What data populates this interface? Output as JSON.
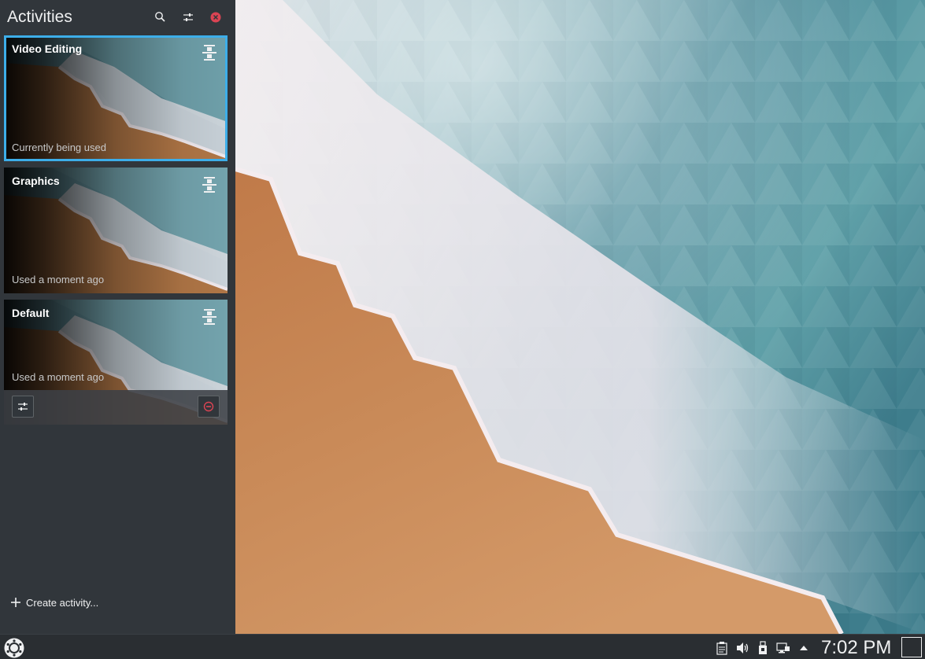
{
  "activities_panel": {
    "title": "Activities",
    "search_icon": "search-icon",
    "configure_icon": "sliders-icon",
    "close_icon": "close-icon",
    "accent_color": "#3daee9",
    "close_color": "#da4453",
    "activities": [
      {
        "name": "Video Editing",
        "status": "Currently being used",
        "current": true,
        "pin_icon": "pin-icon"
      },
      {
        "name": "Graphics",
        "status": "Used a moment ago",
        "current": false,
        "pin_icon": "pin-icon"
      },
      {
        "name": "Default",
        "status": "Used a moment ago",
        "current": false,
        "pin_icon": "pin-icon",
        "actions": [
          "configure-icon",
          "stop-icon"
        ]
      }
    ],
    "create_label": "Create activity..."
  },
  "panel": {
    "launcher_icon": "application-launcher-icon",
    "tray_icons": [
      "clipboard-icon",
      "volume-icon",
      "usb-device-icon",
      "network-icon",
      "expand-tray-icon"
    ],
    "clock": "7:02 PM",
    "show_desktop_icon": "show-desktop-icon"
  }
}
